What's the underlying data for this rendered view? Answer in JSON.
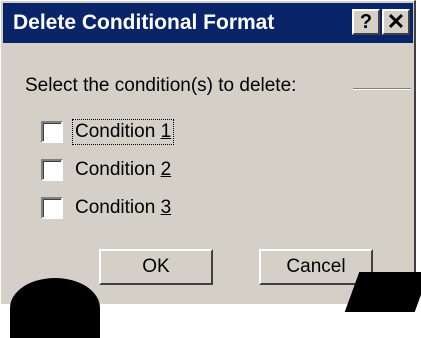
{
  "dialog": {
    "title": "Delete Conditional Format",
    "help_button": "?",
    "close_button": "✕"
  },
  "prompt": "Select the condition(s) to delete:",
  "conditions": [
    {
      "label": "Condition ",
      "accel": "1",
      "checked": false,
      "focused": true
    },
    {
      "label": "Condition ",
      "accel": "2",
      "checked": false,
      "focused": false
    },
    {
      "label": "Condition ",
      "accel": "3",
      "checked": false,
      "focused": false
    }
  ],
  "buttons": {
    "ok": "OK",
    "cancel": "Cancel"
  }
}
